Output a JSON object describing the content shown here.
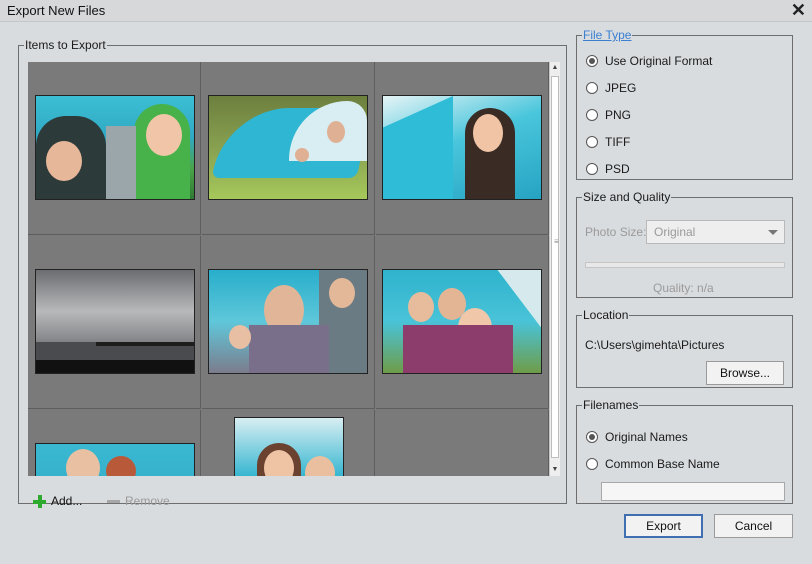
{
  "window": {
    "title": "Export New Files",
    "close_icon": "close-icon",
    "close_glyph": "✕"
  },
  "items": {
    "legend": "Items to Export",
    "add_label": "Add...",
    "remove_label": "Remove",
    "thumbnails": [
      "two-girls-sleeping-bag",
      "tent-on-grass",
      "girl-in-tent",
      "pier-cloudy-sky",
      "family-in-tent",
      "girls-with-mother-in-tent",
      "girl-laughing-in-tent",
      "mother-and-daughter-in-tent"
    ]
  },
  "file_type": {
    "legend": "File Type",
    "options": [
      {
        "label": "Use Original Format",
        "checked": true
      },
      {
        "label": "JPEG",
        "checked": false
      },
      {
        "label": "PNG",
        "checked": false
      },
      {
        "label": "TIFF",
        "checked": false
      },
      {
        "label": "PSD",
        "checked": false
      }
    ]
  },
  "size_quality": {
    "legend": "Size and Quality",
    "photo_size_label": "Photo Size:",
    "photo_size_value": "Original",
    "quality_label": "Quality: n/a"
  },
  "location": {
    "legend": "Location",
    "path": "C:\\Users\\gimehta\\Pictures",
    "browse_label": "Browse..."
  },
  "filenames": {
    "legend": "Filenames",
    "options": [
      {
        "label": "Original Names",
        "checked": true
      },
      {
        "label": "Common Base Name",
        "checked": false
      }
    ],
    "base_name_value": ""
  },
  "buttons": {
    "export_label": "Export",
    "cancel_label": "Cancel"
  },
  "colors": {
    "link_blue": "#3a7fd0",
    "grid_gray": "#7a7a7a",
    "add_green": "#2eaa2e",
    "default_border": "#3f6fb0"
  }
}
